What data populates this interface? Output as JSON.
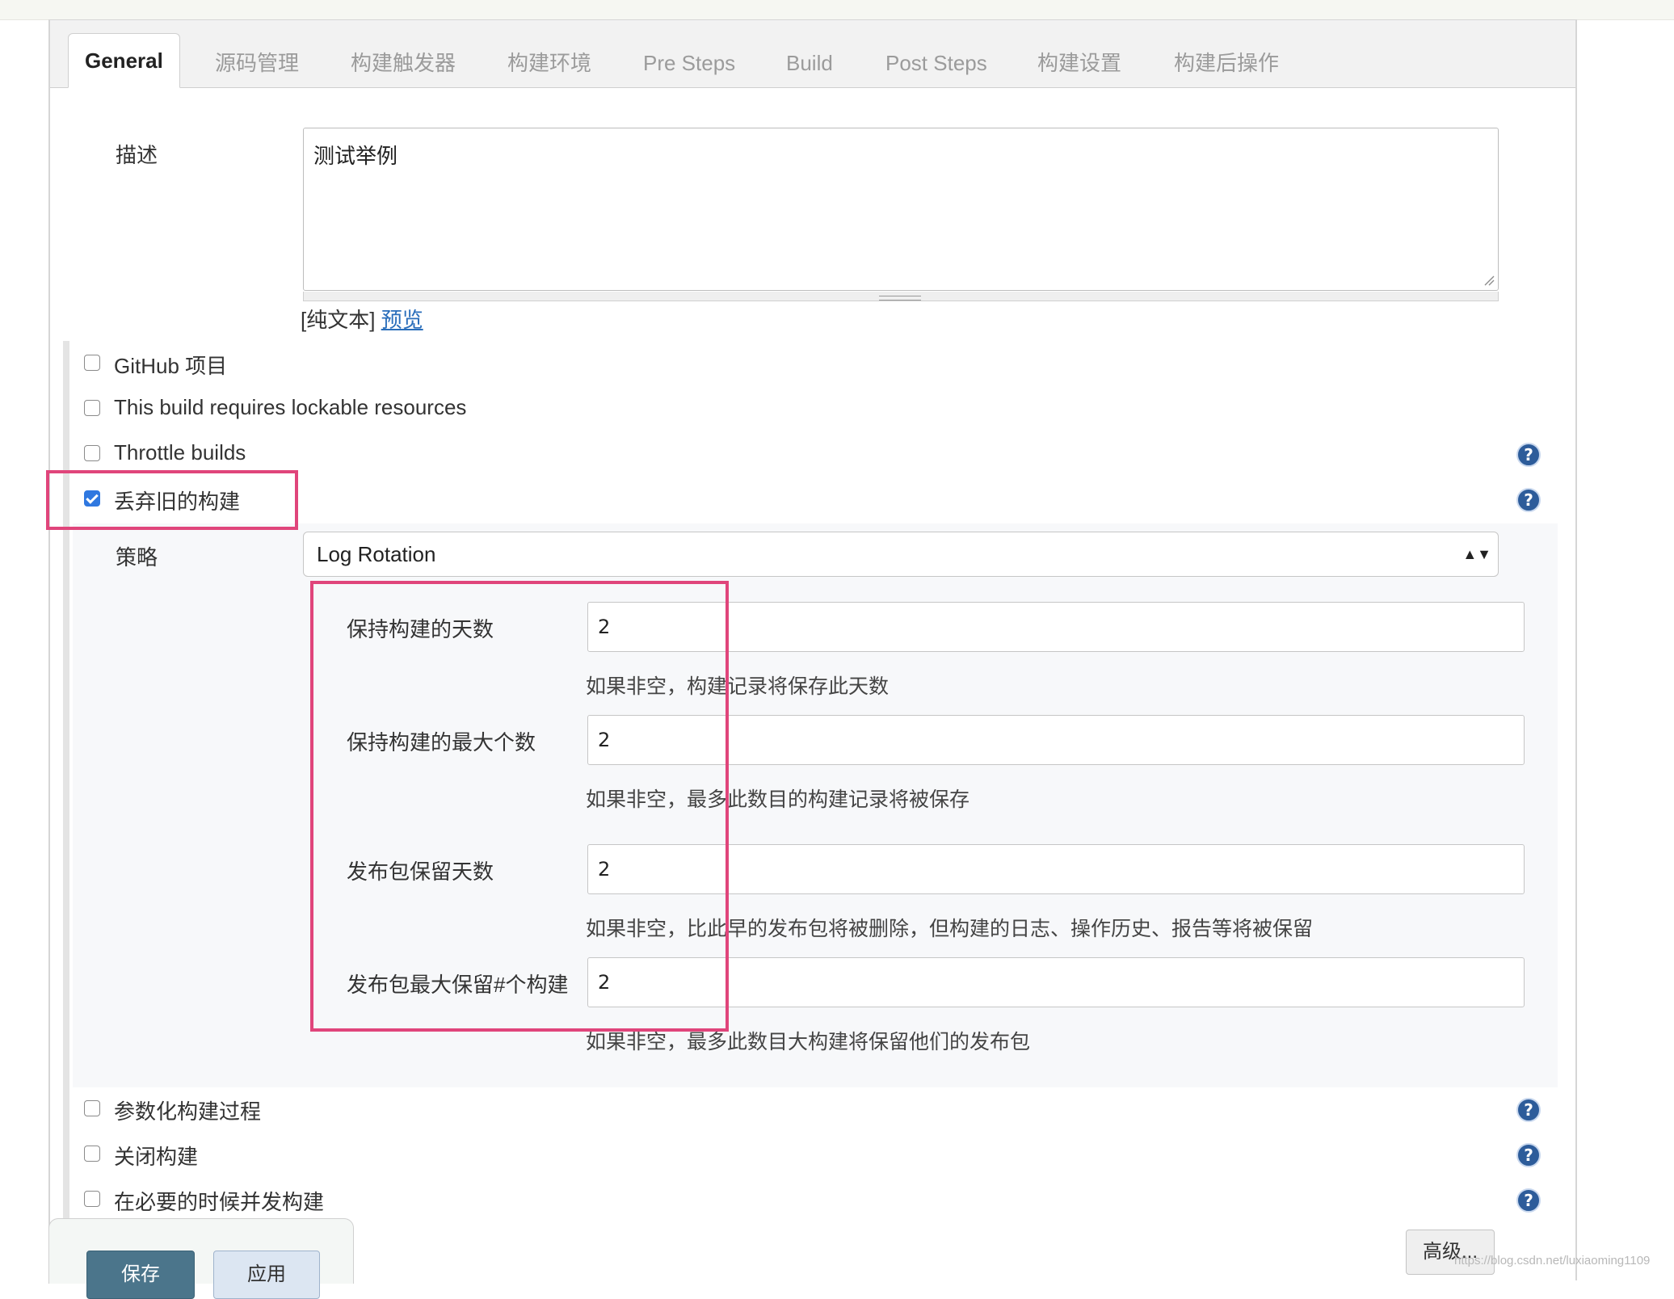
{
  "tabs": [
    "General",
    "源码管理",
    "构建触发器",
    "构建环境",
    "Pre Steps",
    "Build",
    "Post Steps",
    "构建设置",
    "构建后操作"
  ],
  "description": {
    "label": "描述",
    "value": "测试举例",
    "plain_text": "[纯文本]",
    "preview": "预览"
  },
  "options": {
    "github": "GitHub 项目",
    "lockable": "This build requires lockable resources",
    "throttle": "Throttle builds",
    "discard": "丢弃旧的构建",
    "discard_checked": true
  },
  "strategy": {
    "label": "策略",
    "value": "Log Rotation",
    "arrows": "▲▼"
  },
  "rotation_fields": [
    {
      "label": "保持构建的天数",
      "value": "2",
      "hint": "如果非空，构建记录将保存此天数"
    },
    {
      "label": "保持构建的最大个数",
      "value": "2",
      "hint": "如果非空，最多此数目的构建记录将被保存"
    },
    {
      "label": "发布包保留天数",
      "value": "2",
      "hint": "如果非空，比此早的发布包将被删除，但构建的日志、操作历史、报告等将被保留"
    },
    {
      "label": "发布包最大保留#个构建",
      "value": "2",
      "hint": "如果非空，最多此数目大构建将保留他们的发布包"
    }
  ],
  "more_options": {
    "parameterized": "参数化构建过程",
    "disable": "关闭构建",
    "concurrent": "在必要的时候并发构建"
  },
  "help_glyph": "?",
  "buttons": {
    "save": "保存",
    "apply": "应用",
    "advanced": "高级..."
  },
  "watermark": "https://blog.csdn.net/luxiaoming1109",
  "colors": {
    "accent_checkbox": "#2f78e0",
    "highlight": "#e0457b",
    "link": "#2a6ebb",
    "help_icon": "#2d5c9a",
    "save_button": "#4b758b"
  }
}
